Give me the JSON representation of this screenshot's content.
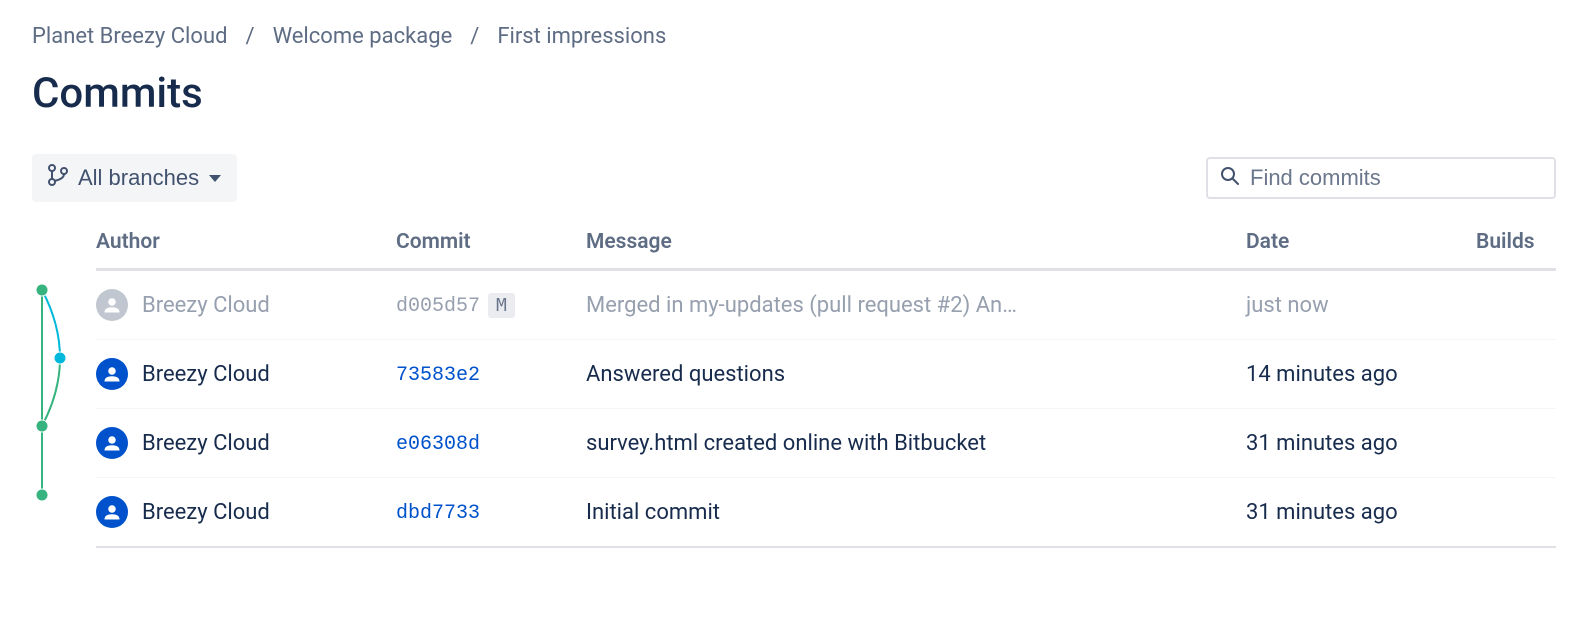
{
  "breadcrumb": [
    {
      "label": "Planet Breezy Cloud"
    },
    {
      "label": "Welcome package"
    },
    {
      "label": "First impressions"
    }
  ],
  "page_title": "Commits",
  "branch_filter": {
    "label": "All branches"
  },
  "search": {
    "placeholder": "Find commits"
  },
  "columns": {
    "author": "Author",
    "commit": "Commit",
    "message": "Message",
    "date": "Date",
    "builds": "Builds"
  },
  "commits": [
    {
      "author": "Breezy Cloud",
      "hash": "d005d57",
      "merge_badge": "M",
      "message": "Merged in my-updates (pull request #2) An…",
      "date": "just now",
      "muted": true
    },
    {
      "author": "Breezy Cloud",
      "hash": "73583e2",
      "message": "Answered questions",
      "date": "14 minutes ago",
      "muted": false
    },
    {
      "author": "Breezy Cloud",
      "hash": "e06308d",
      "message": "survey.html created online with Bitbucket",
      "date": "31 minutes ago",
      "muted": false
    },
    {
      "author": "Breezy Cloud",
      "hash": "dbd7733",
      "message": "Initial commit",
      "date": "31 minutes ago",
      "muted": false
    }
  ],
  "graph": {
    "green": "#36B37E",
    "teal": "#00B8D9"
  }
}
